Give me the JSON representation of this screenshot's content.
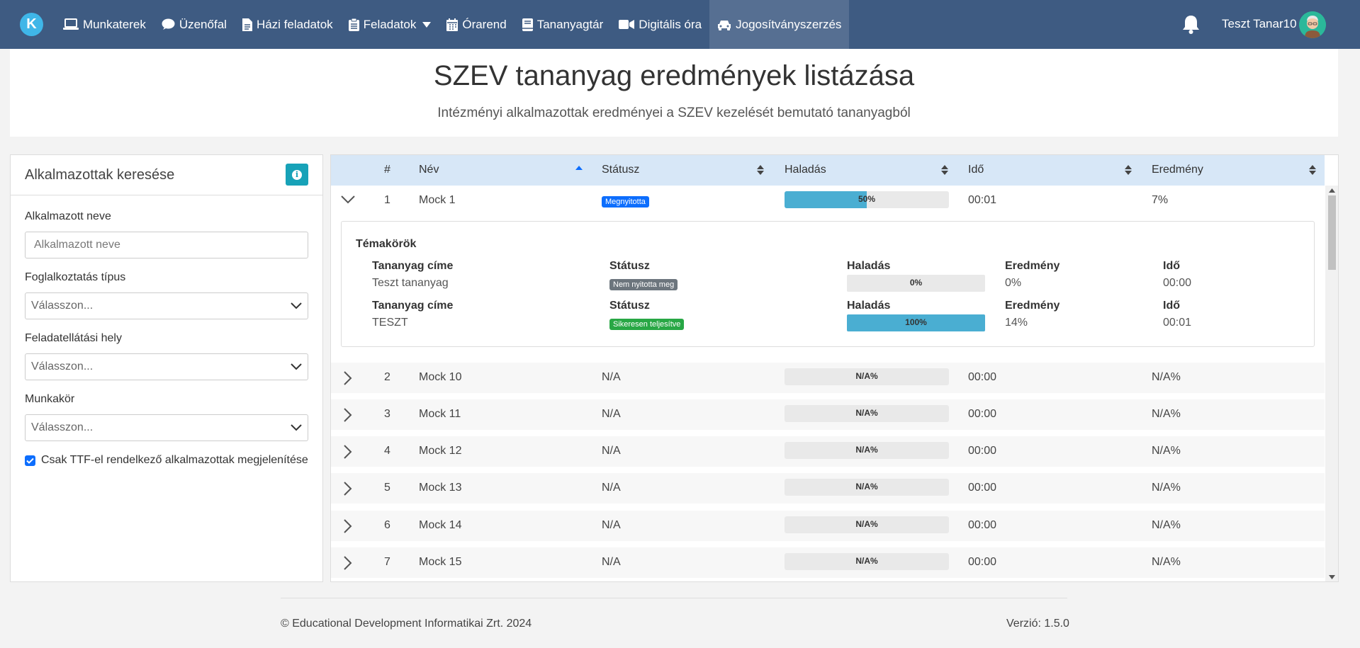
{
  "navbar": {
    "logo_letter": "K",
    "items": [
      {
        "label": "Munkaterek",
        "icon": "laptop-icon"
      },
      {
        "label": "Üzenőfal",
        "icon": "chat-icon"
      },
      {
        "label": "Házi feladatok",
        "icon": "document-icon"
      },
      {
        "label": "Feladatok",
        "icon": "clipboard-icon"
      },
      {
        "label": "Órarend",
        "icon": "calendar-icon"
      },
      {
        "label": "Tananyagtár",
        "icon": "book-icon"
      },
      {
        "label": "Digitális óra",
        "icon": "video-icon"
      },
      {
        "label": "Jogosítványszerzés",
        "icon": "car-icon"
      }
    ],
    "active_item": "Jogosítványszerzés",
    "user_name": "Teszt Tanar10"
  },
  "header": {
    "title": "SZEV tananyag eredmények listázása",
    "subtitle": "Intézményi alkalmazottak eredményei a SZEV kezelését bemutató tananyagból"
  },
  "search": {
    "title": "Alkalmazottak keresése",
    "name_label": "Alkalmazott neve",
    "name_placeholder": "Alkalmazott neve",
    "employment_label": "Foglalkoztatás típus",
    "employment_value": "Válasszon...",
    "location_label": "Feladatellátási hely",
    "location_value": "Válasszon...",
    "position_label": "Munkakör",
    "position_value": "Válasszon...",
    "ttf_checkbox_label": "Csak TTF-el rendelkező alkalmazottak megjelenítése",
    "ttf_checked": true
  },
  "table": {
    "columns": [
      "#",
      "Név",
      "Státusz",
      "Haladás",
      "Idő",
      "Eredmény"
    ],
    "rows": [
      {
        "num": "1",
        "name": "Mock 1",
        "status": "Megnyitotta",
        "progress": 50,
        "progress_label": "50%",
        "time": "00:01",
        "result": "7%",
        "expanded": true
      },
      {
        "num": "2",
        "name": "Mock 10",
        "status": "N/A",
        "progress": 0,
        "progress_label": "N/A%",
        "time": "00:00",
        "result": "N/A%"
      },
      {
        "num": "3",
        "name": "Mock 11",
        "status": "N/A",
        "progress": 0,
        "progress_label": "N/A%",
        "time": "00:00",
        "result": "N/A%"
      },
      {
        "num": "4",
        "name": "Mock 12",
        "status": "N/A",
        "progress": 0,
        "progress_label": "N/A%",
        "time": "00:00",
        "result": "N/A%"
      },
      {
        "num": "5",
        "name": "Mock 13",
        "status": "N/A",
        "progress": 0,
        "progress_label": "N/A%",
        "time": "00:00",
        "result": "N/A%"
      },
      {
        "num": "6",
        "name": "Mock 14",
        "status": "N/A",
        "progress": 0,
        "progress_label": "N/A%",
        "time": "00:00",
        "result": "N/A%"
      },
      {
        "num": "7",
        "name": "Mock 15",
        "status": "N/A",
        "progress": 0,
        "progress_label": "N/A%",
        "time": "00:00",
        "result": "N/A%"
      }
    ],
    "detail": {
      "title": "Témakörök",
      "headers": {
        "material": "Tananyag címe",
        "status": "Státusz",
        "progress": "Haladás",
        "result": "Eredmény",
        "time": "Idő"
      },
      "items": [
        {
          "material": "Teszt tananyag",
          "status": "Nem nyitotta meg",
          "status_color": "#6c757d",
          "progress": 0,
          "progress_label": "0%",
          "result": "0%",
          "time": "00:00"
        },
        {
          "material": "TESZT",
          "status": "Sikeresen teljesítve",
          "status_color": "#28a745",
          "progress": 100,
          "progress_label": "100%",
          "result": "14%",
          "time": "00:01"
        }
      ]
    }
  },
  "footer": {
    "copyright": "© Educational Development Informatikai Zrt. 2024",
    "version": "Verzió: 1.5.0"
  },
  "colors": {
    "navbar": "#3e5b82",
    "accent": "#17a2b8",
    "progress": "#4aaed2",
    "badge_open": "#0d6efd"
  }
}
